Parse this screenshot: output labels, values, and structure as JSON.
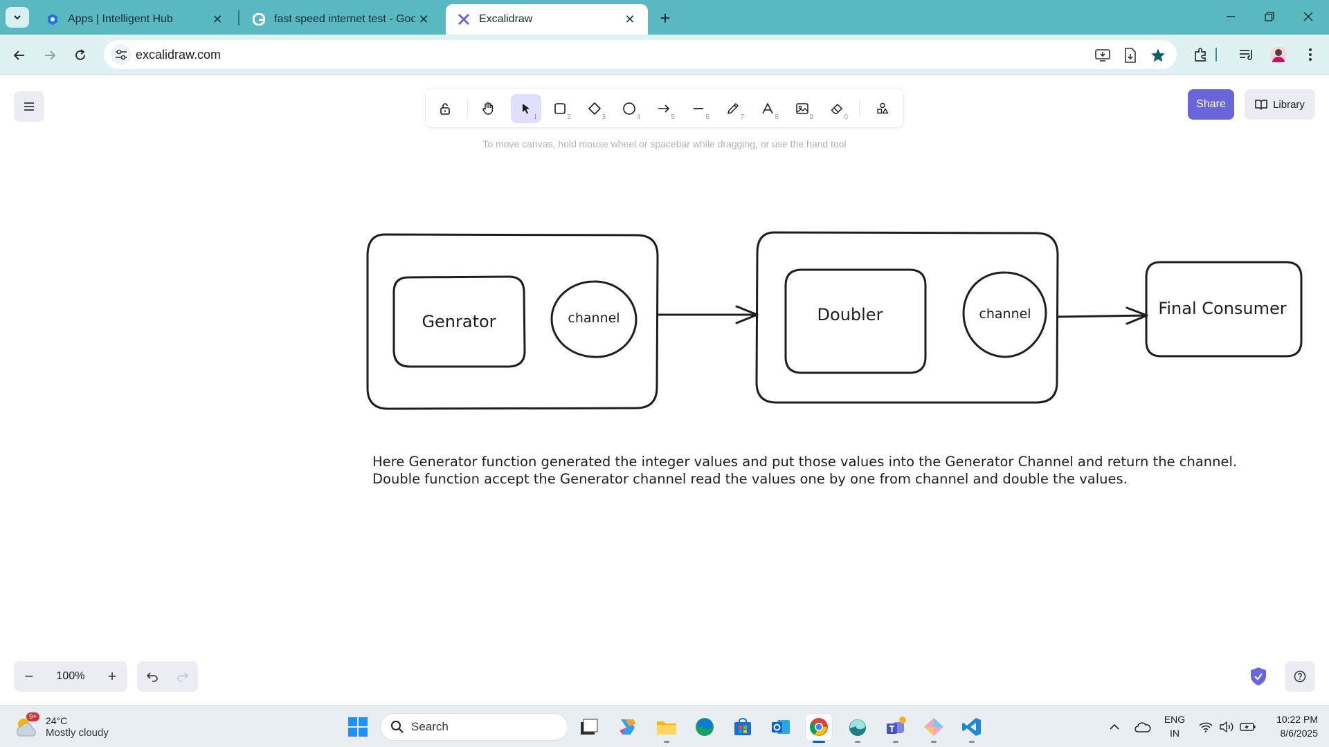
{
  "browser": {
    "tabs": [
      {
        "title": "Apps | Intelligent Hub",
        "icon": "intelligent-hub-icon"
      },
      {
        "title": "fast speed internet test - Googl",
        "icon": "google-icon"
      },
      {
        "title": "Excalidraw",
        "icon": "excalidraw-icon",
        "active": true
      }
    ],
    "url": "excalidraw.com",
    "colors": {
      "frame": "#5ab8c1",
      "toolbar": "#dff1f3"
    }
  },
  "excalidraw": {
    "toolbar": {
      "tools": [
        {
          "name": "lock",
          "key": ""
        },
        {
          "name": "hand",
          "key": ""
        },
        {
          "name": "selection",
          "key": "1",
          "selected": true
        },
        {
          "name": "rectangle",
          "key": "2"
        },
        {
          "name": "diamond",
          "key": "3"
        },
        {
          "name": "ellipse",
          "key": "4"
        },
        {
          "name": "arrow",
          "key": "5"
        },
        {
          "name": "line",
          "key": "6"
        },
        {
          "name": "draw",
          "key": "7"
        },
        {
          "name": "text",
          "key": "8"
        },
        {
          "name": "image",
          "key": "9"
        },
        {
          "name": "eraser",
          "key": "0"
        },
        {
          "name": "extra-tools",
          "key": ""
        }
      ]
    },
    "hint": "To move canvas, hold mouse wheel or spacebar while dragging, or use the hand tool",
    "share_label": "Share",
    "library_label": "Library",
    "zoom": "100%",
    "accent": "#6965db",
    "diagram": {
      "generator_label": "Genrator",
      "channel1_label": "channel",
      "doubler_label": "Doubler",
      "channel2_label": "channel",
      "consumer_label": "Final Consumer",
      "note_line1": "Here Generator function generated the integer values and put those values into the Generator Channel and return the channel.",
      "note_line2": "Double function accept the Generator channel read the values one by one from channel and double the values."
    }
  },
  "taskbar": {
    "weather_temp": "24°C",
    "weather_cond": "Mostly cloudy",
    "weather_badge": "9+",
    "search_placeholder": "Search",
    "lang_line1": "ENG",
    "lang_line2": "IN",
    "time": "10:22 PM",
    "date": "8/6/2025"
  }
}
